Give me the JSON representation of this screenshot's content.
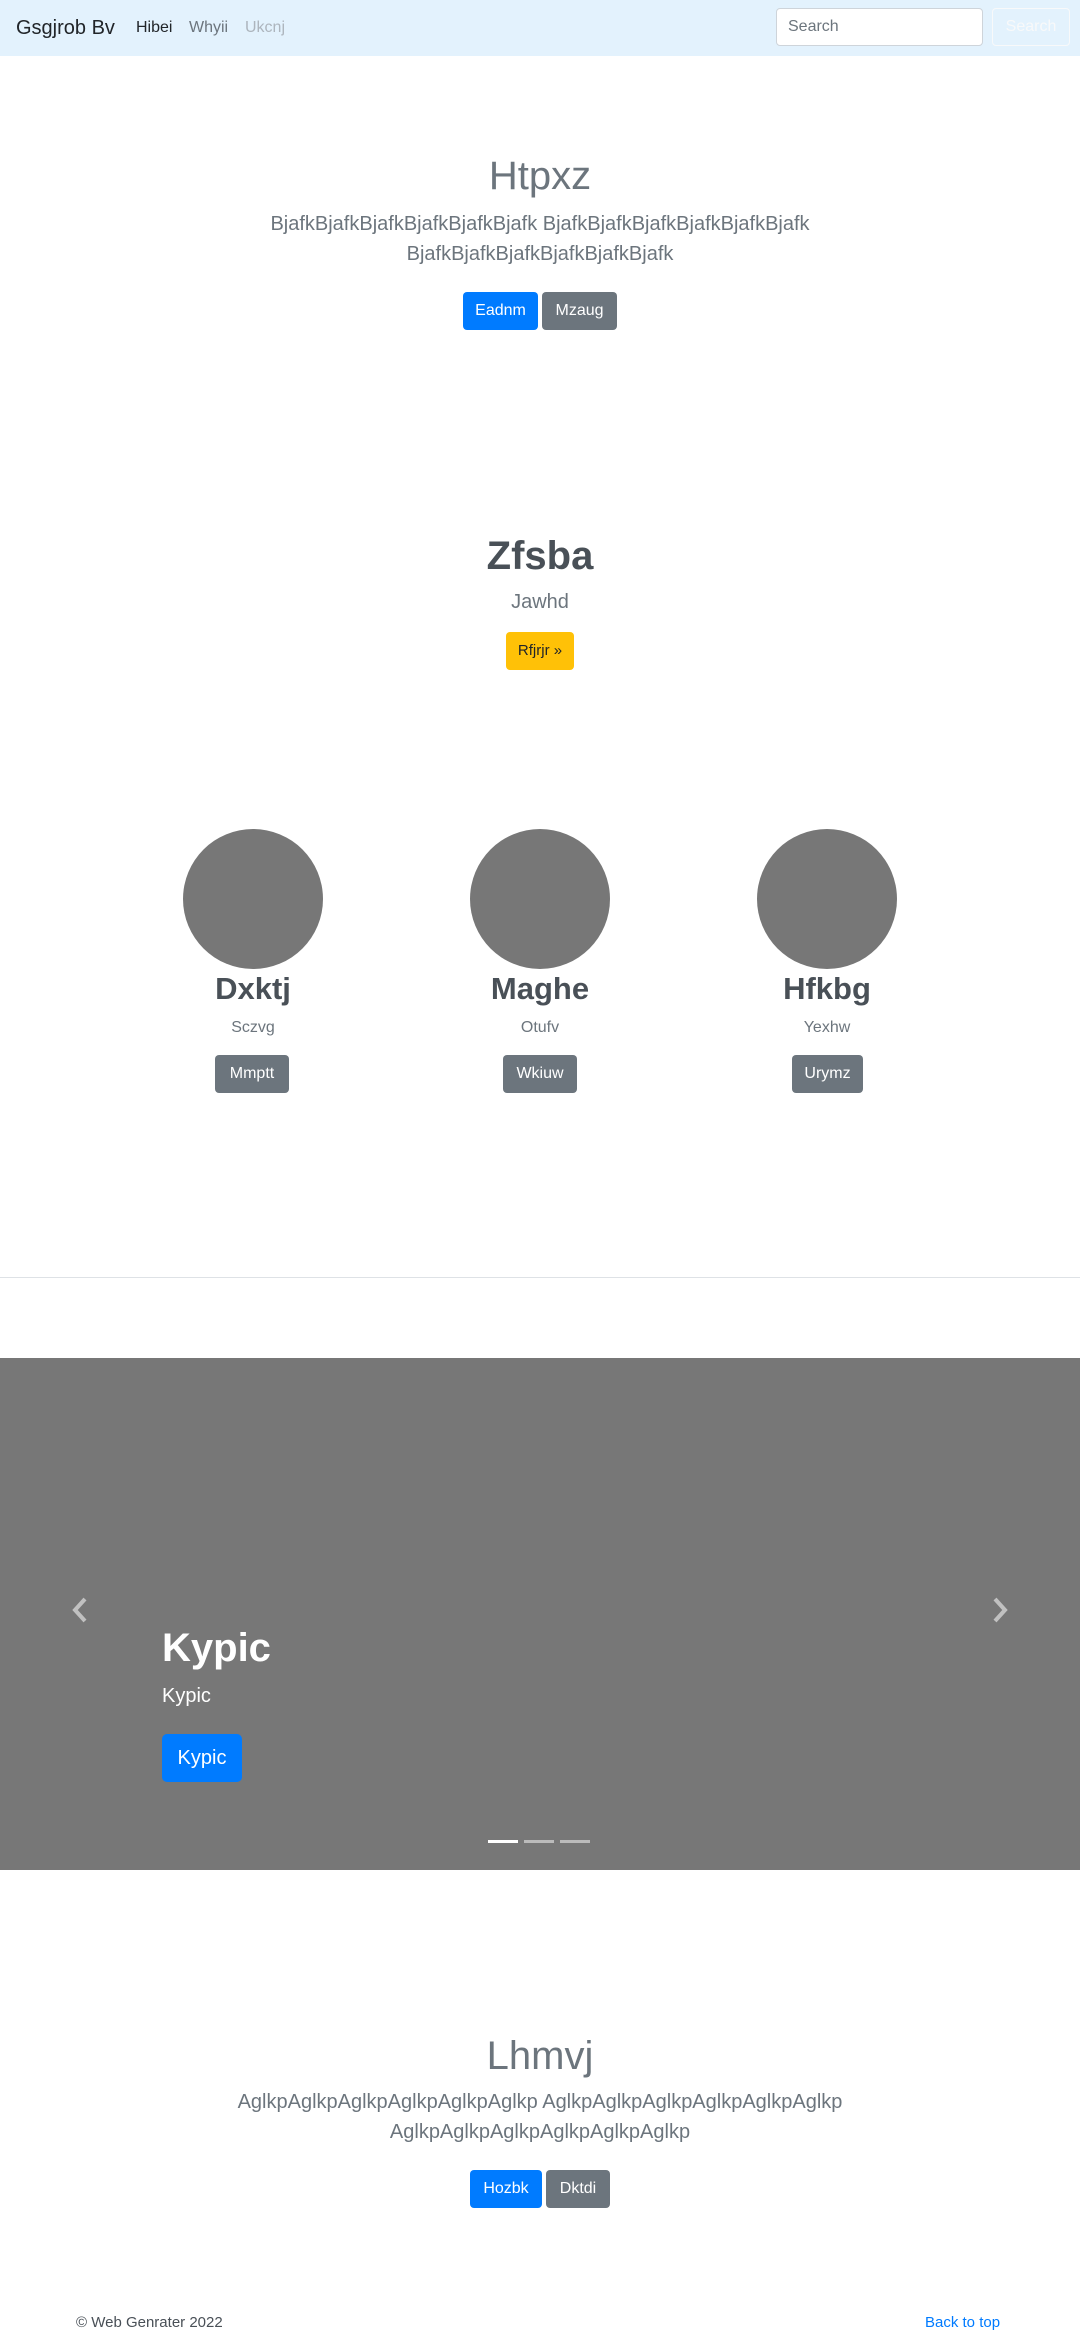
{
  "navbar": {
    "brand": "Gsgjrob Bv",
    "links": [
      "Hibei",
      "Whyii",
      "Ukcnj"
    ],
    "search_placeholder": "Search",
    "search_button": "Search"
  },
  "hero": {
    "title": "Htpxz",
    "lead_line1": "BjafkBjafkBjafkBjafkBjafkBjafk BjafkBjafkBjafkBjafkBjafkBjafk",
    "lead_line2": "BjafkBjafkBjafkBjafkBjafkBjafk",
    "primary_button": "Eadnm",
    "secondary_button": "Mzaug"
  },
  "feature": {
    "title": "Zfsba",
    "subtitle": "Jawhd",
    "button": "Rfjrjr »"
  },
  "columns": [
    {
      "title": "Dxktj",
      "subtitle": "Sczvg",
      "button": "Mmptt"
    },
    {
      "title": "Maghe",
      "subtitle": "Otufv",
      "button": "Wkiuw"
    },
    {
      "title": "Hfkbg",
      "subtitle": "Yexhw",
      "button": "Urymz"
    }
  ],
  "carousel": {
    "title": "Kypic",
    "subtitle": "Kypic",
    "button": "Kypic",
    "prev_icon": "chevron-left",
    "next_icon": "chevron-right",
    "slide_count": 3,
    "active_slide": 1
  },
  "hero2": {
    "title": "Lhmvj",
    "lead_line1": "AglkpAglkpAglkpAglkpAglkpAglkp AglkpAglkpAglkpAglkpAglkpAglkp",
    "lead_line2": "AglkpAglkpAglkpAglkpAglkpAglkp",
    "primary_button": "Hozbk",
    "secondary_button": "Dktdi"
  },
  "footer": {
    "copyright": "© Web Genrater 2022",
    "back_to_top": "Back to top"
  },
  "colors": {
    "navbar_bg": "#e3f2fd",
    "primary": "#007bff",
    "secondary": "#6c757d",
    "warning": "#ffc107",
    "placeholder_gray": "#777777"
  }
}
